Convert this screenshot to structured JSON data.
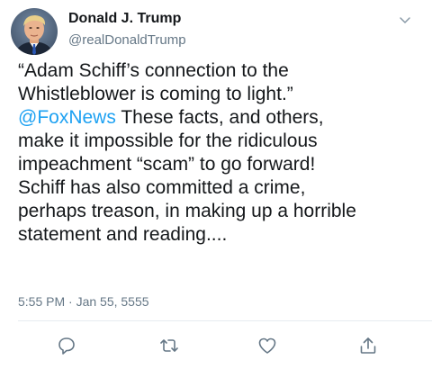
{
  "tweet": {
    "author": {
      "display_name": "Donald J. Trump",
      "handle": "@realDonaldTrump",
      "avatar_icon": "profile-avatar"
    },
    "menu_icon": "chevron-down-icon",
    "lines": [
      "“Adam Schiff’s connection to the",
      "Whistleblower is coming to light.”",
      "These facts, and others,",
      "make it impossible for the ridiculous",
      "impeachment “scam” to go forward!",
      "Schiff has also committed a crime,",
      "perhaps treason, in making up a horrible",
      "statement and reading...."
    ],
    "mention": "@FoxNews",
    "timestamp": "5:55 PM · Jan 55, 5555",
    "actions": {
      "reply_icon": "reply-icon",
      "retweet_icon": "retweet-icon",
      "like_icon": "heart-icon",
      "share_icon": "share-icon"
    }
  },
  "colors": {
    "text": "#14171a",
    "secondary": "#657786",
    "link": "#1da1f2",
    "divider": "#e6ecf0"
  }
}
